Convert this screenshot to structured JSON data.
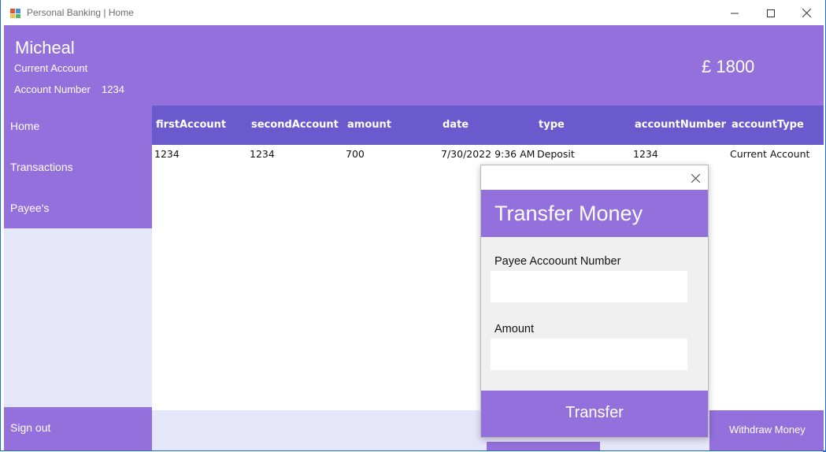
{
  "window": {
    "title": "Personal Banking | Home",
    "icon": "app-icon",
    "controls": [
      "minimize-icon",
      "maximize-icon",
      "close-icon"
    ]
  },
  "header": {
    "user_name": "Micheal",
    "account_type": "Current Account",
    "account_number_label": "Account Number",
    "account_number": "1234",
    "balance": "£ 1800"
  },
  "sidebar": {
    "items": [
      {
        "label": "Home"
      },
      {
        "label": "Transactions"
      },
      {
        "label": "Payee's"
      }
    ],
    "sign_out": "Sign out"
  },
  "table": {
    "columns": [
      "firstAccount",
      "secondAccount",
      "amount",
      "date",
      "type",
      "accountNumber",
      "accountType"
    ],
    "rows": [
      [
        "1234",
        "1234",
        "700",
        "7/30/2022 9:36 AM",
        "Deposit",
        "1234",
        "Current Account"
      ]
    ]
  },
  "actions": {
    "withdraw": "Withdraw Money"
  },
  "dialog": {
    "title": "Transfer Money",
    "payee_label": "Payee Accoount Number",
    "payee_value": "",
    "amount_label": "Amount",
    "amount_value": "",
    "submit": "Transfer"
  },
  "colors": {
    "accent": "#9370db",
    "header_row": "#6a5acd",
    "sidebar_bg": "#e6e6fa"
  }
}
